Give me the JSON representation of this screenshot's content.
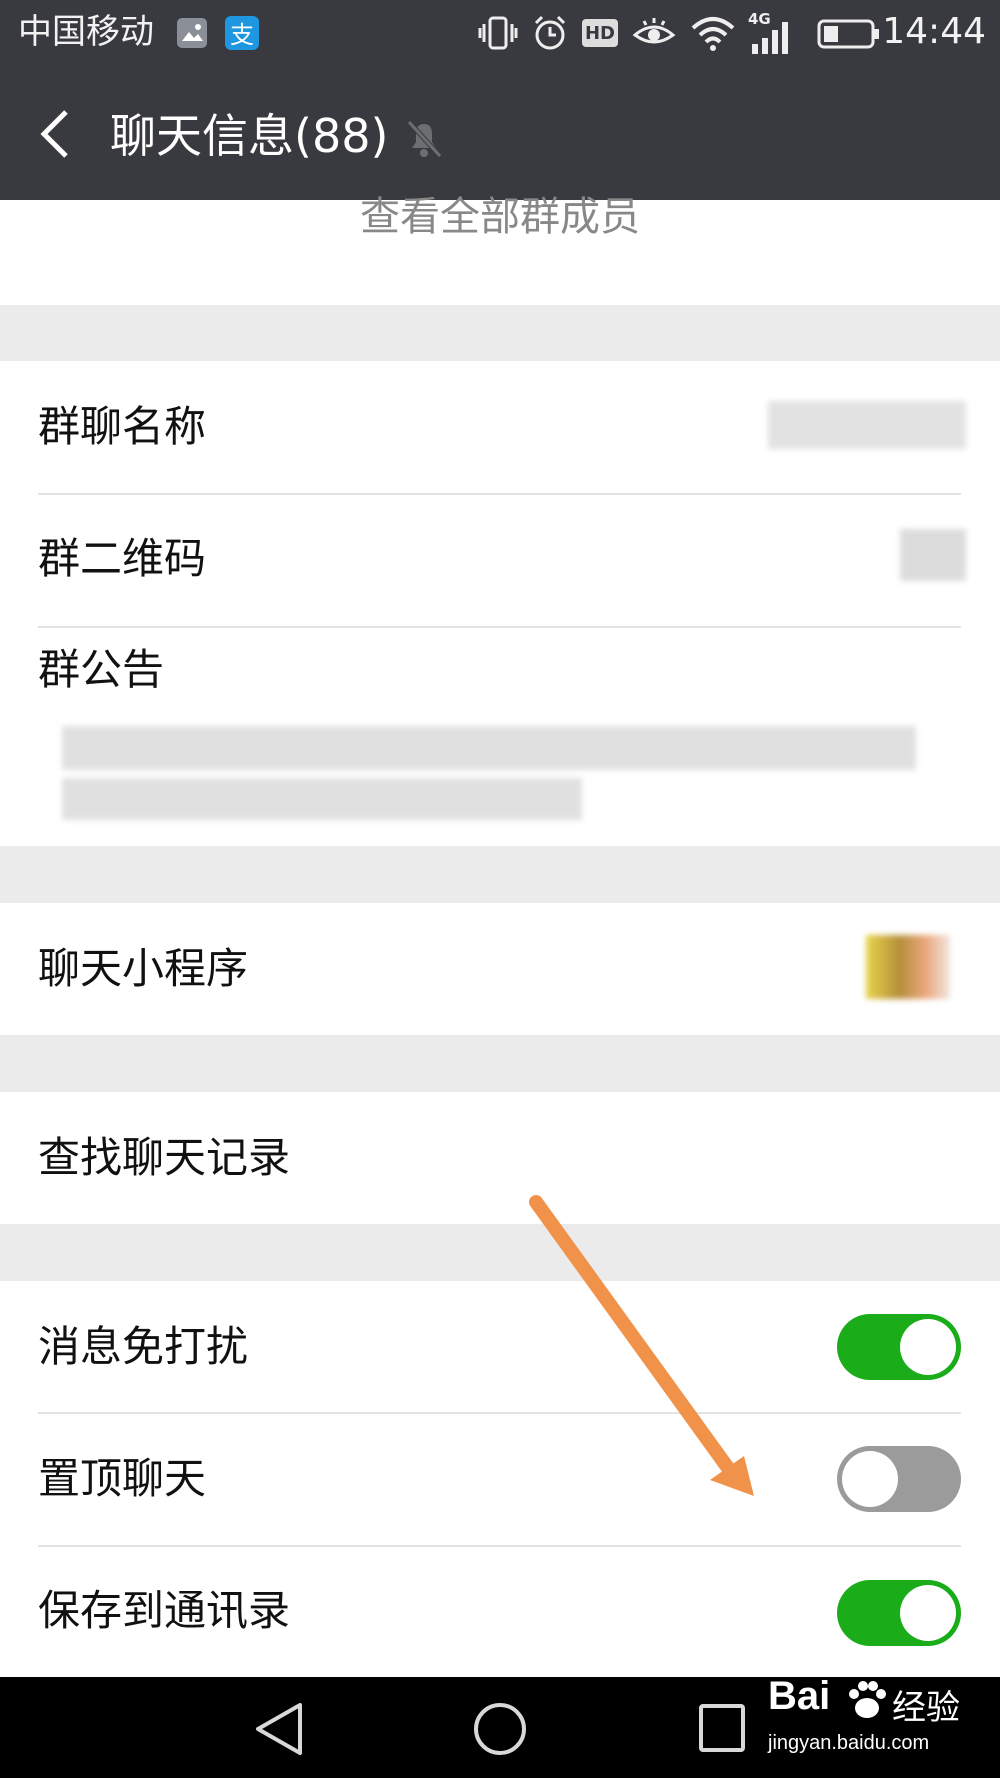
{
  "status_bar": {
    "carrier": "中国移动",
    "time": "14:44",
    "hd_label": "HD",
    "network_label": "4G",
    "icons": [
      "gallery-icon",
      "alipay-icon",
      "vibrate-icon",
      "alarm-icon",
      "hd-icon",
      "eye-icon",
      "wifi-icon",
      "signal-icon",
      "battery-icon"
    ]
  },
  "header": {
    "title": "聊天信息(88)",
    "back_icon": "back-arrow-icon",
    "mute_icon": "bell-muted-icon"
  },
  "members": {
    "view_all_label": "查看全部群成员"
  },
  "settings": {
    "group_name_label": "群聊名称",
    "group_qr_label": "群二维码",
    "announcement_label": "群公告",
    "mini_program_label": "聊天小程序",
    "search_history_label": "查找聊天记录",
    "toggles": [
      {
        "label": "消息免打扰",
        "on": true
      },
      {
        "label": "置顶聊天",
        "on": false
      },
      {
        "label": "保存到通讯录",
        "on": true
      }
    ]
  },
  "watermark": {
    "brand": "Bai",
    "brand_cn": "经验",
    "url": "jingyan.baidu.com"
  },
  "colors": {
    "header_bg": "#393a3f",
    "toggle_on": "#1aad19",
    "toggle_off": "#9b9b9b",
    "annotation_arrow": "#f0924a"
  }
}
